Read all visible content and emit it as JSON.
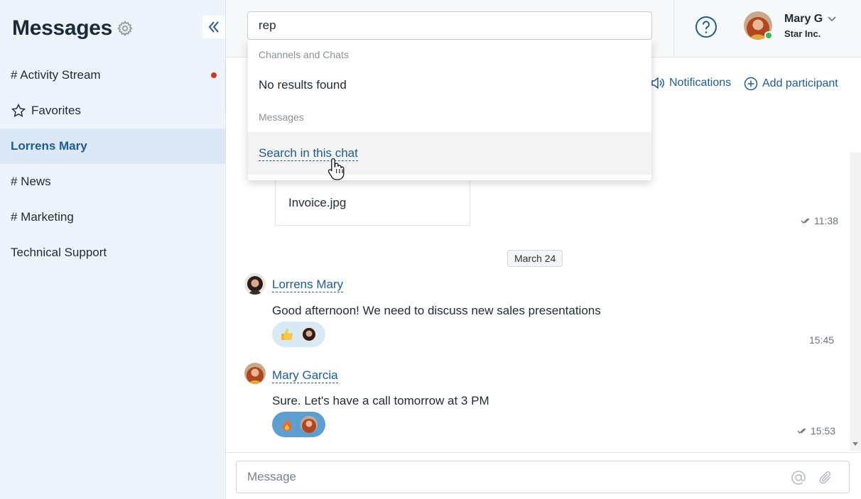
{
  "sidebar": {
    "title": "Messages",
    "items": [
      {
        "label": "# Activity Stream",
        "unread": true
      },
      {
        "label": "Favorites"
      },
      {
        "label": "Lorrens Mary",
        "active": true
      },
      {
        "label": "# News"
      },
      {
        "label": "# Marketing"
      },
      {
        "label": "Technical Support"
      }
    ]
  },
  "search": {
    "value": "rep"
  },
  "header": {
    "help_icon": "question-circle-icon",
    "user_name": "Mary G",
    "user_company": "Star Inc."
  },
  "chat_header": {
    "notifications_label": "Notifications",
    "add_participant_label": "Add participant"
  },
  "dropdown": {
    "section_channels": "Channels and Chats",
    "no_results": "No results found",
    "section_messages": "Messages",
    "search_in_chat": "Search in this chat"
  },
  "feed": {
    "file_name": "Invoice.jpg",
    "file_time": "11:38",
    "date_chip": "March 24",
    "messages": [
      {
        "author": "Lorrens Mary",
        "text": "Good afternoon! We need to discuss new sales presentations",
        "time": "15:45",
        "reaction": "thumbs-up"
      },
      {
        "author": "Mary Garcia",
        "text": "Sure. Let's have a call tomorrow at 3 PM",
        "time": "15:53",
        "reaction": "fire"
      }
    ]
  },
  "composer": {
    "placeholder": "Message"
  },
  "colors": {
    "accent": "#1c5c93",
    "sidebar_bg": "#eef4fb",
    "unread_dot": "#d3371a",
    "online": "#3ab84f"
  }
}
